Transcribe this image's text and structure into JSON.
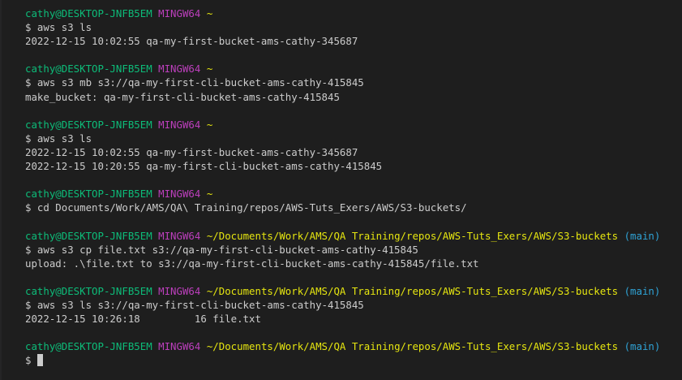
{
  "terminal": {
    "sections": [
      {
        "user": "cathy@DESKTOP-JNFB5EM",
        "system": "MINGW64",
        "path": "~",
        "branch": "",
        "command": "$ aws s3 ls",
        "output": [
          "2022-12-15 10:02:55 qa-my-first-bucket-ams-cathy-345687"
        ]
      },
      {
        "user": "cathy@DESKTOP-JNFB5EM",
        "system": "MINGW64",
        "path": "~",
        "branch": "",
        "command": "$ aws s3 mb s3://qa-my-first-cli-bucket-ams-cathy-415845",
        "output": [
          "make_bucket: qa-my-first-cli-bucket-ams-cathy-415845"
        ]
      },
      {
        "user": "cathy@DESKTOP-JNFB5EM",
        "system": "MINGW64",
        "path": "~",
        "branch": "",
        "command": "$ aws s3 ls",
        "output": [
          "2022-12-15 10:02:55 qa-my-first-bucket-ams-cathy-345687",
          "2022-12-15 10:20:55 qa-my-first-cli-bucket-ams-cathy-415845"
        ]
      },
      {
        "user": "cathy@DESKTOP-JNFB5EM",
        "system": "MINGW64",
        "path": "~",
        "branch": "",
        "command": "$ cd Documents/Work/AMS/QA\\ Training/repos/AWS-Tuts_Exers/AWS/S3-buckets/",
        "output": []
      },
      {
        "user": "cathy@DESKTOP-JNFB5EM",
        "system": "MINGW64",
        "path": "~/Documents/Work/AMS/QA Training/repos/AWS-Tuts_Exers/AWS/S3-buckets",
        "branch": "(main)",
        "command": "$ aws s3 cp file.txt s3://qa-my-first-cli-bucket-ams-cathy-415845",
        "output": [
          "upload: .\\file.txt to s3://qa-my-first-cli-bucket-ams-cathy-415845/file.txt"
        ]
      },
      {
        "user": "cathy@DESKTOP-JNFB5EM",
        "system": "MINGW64",
        "path": "~/Documents/Work/AMS/QA Training/repos/AWS-Tuts_Exers/AWS/S3-buckets",
        "branch": "(main)",
        "command": "$ aws s3 ls s3://qa-my-first-cli-bucket-ams-cathy-415845",
        "output": [
          "2022-12-15 10:26:18         16 file.txt"
        ]
      }
    ],
    "final_prompt": {
      "user": "cathy@DESKTOP-JNFB5EM",
      "system": "MINGW64",
      "path": "~/Documents/Work/AMS/QA Training/repos/AWS-Tuts_Exers/AWS/S3-buckets",
      "branch": "(main)",
      "input": "$ "
    },
    "colors": {
      "background": "#1e1e1e",
      "text": "#cccccc",
      "user": "#0dbc79",
      "system": "#bc3fbc",
      "path": "#e5e510",
      "branch": "#2fa3d6"
    }
  }
}
